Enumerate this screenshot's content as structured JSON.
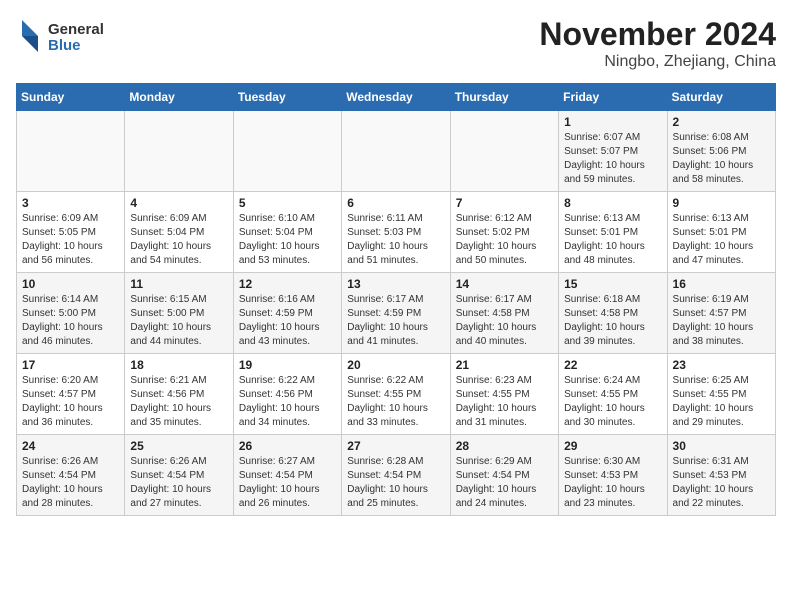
{
  "header": {
    "logo_general": "General",
    "logo_blue": "Blue",
    "title": "November 2024",
    "subtitle": "Ningbo, Zhejiang, China"
  },
  "weekdays": [
    "Sunday",
    "Monday",
    "Tuesday",
    "Wednesday",
    "Thursday",
    "Friday",
    "Saturday"
  ],
  "weeks": [
    [
      {
        "day": "",
        "detail": ""
      },
      {
        "day": "",
        "detail": ""
      },
      {
        "day": "",
        "detail": ""
      },
      {
        "day": "",
        "detail": ""
      },
      {
        "day": "",
        "detail": ""
      },
      {
        "day": "1",
        "detail": "Sunrise: 6:07 AM\nSunset: 5:07 PM\nDaylight: 10 hours and 59 minutes."
      },
      {
        "day": "2",
        "detail": "Sunrise: 6:08 AM\nSunset: 5:06 PM\nDaylight: 10 hours and 58 minutes."
      }
    ],
    [
      {
        "day": "3",
        "detail": "Sunrise: 6:09 AM\nSunset: 5:05 PM\nDaylight: 10 hours and 56 minutes."
      },
      {
        "day": "4",
        "detail": "Sunrise: 6:09 AM\nSunset: 5:04 PM\nDaylight: 10 hours and 54 minutes."
      },
      {
        "day": "5",
        "detail": "Sunrise: 6:10 AM\nSunset: 5:04 PM\nDaylight: 10 hours and 53 minutes."
      },
      {
        "day": "6",
        "detail": "Sunrise: 6:11 AM\nSunset: 5:03 PM\nDaylight: 10 hours and 51 minutes."
      },
      {
        "day": "7",
        "detail": "Sunrise: 6:12 AM\nSunset: 5:02 PM\nDaylight: 10 hours and 50 minutes."
      },
      {
        "day": "8",
        "detail": "Sunrise: 6:13 AM\nSunset: 5:01 PM\nDaylight: 10 hours and 48 minutes."
      },
      {
        "day": "9",
        "detail": "Sunrise: 6:13 AM\nSunset: 5:01 PM\nDaylight: 10 hours and 47 minutes."
      }
    ],
    [
      {
        "day": "10",
        "detail": "Sunrise: 6:14 AM\nSunset: 5:00 PM\nDaylight: 10 hours and 46 minutes."
      },
      {
        "day": "11",
        "detail": "Sunrise: 6:15 AM\nSunset: 5:00 PM\nDaylight: 10 hours and 44 minutes."
      },
      {
        "day": "12",
        "detail": "Sunrise: 6:16 AM\nSunset: 4:59 PM\nDaylight: 10 hours and 43 minutes."
      },
      {
        "day": "13",
        "detail": "Sunrise: 6:17 AM\nSunset: 4:59 PM\nDaylight: 10 hours and 41 minutes."
      },
      {
        "day": "14",
        "detail": "Sunrise: 6:17 AM\nSunset: 4:58 PM\nDaylight: 10 hours and 40 minutes."
      },
      {
        "day": "15",
        "detail": "Sunrise: 6:18 AM\nSunset: 4:58 PM\nDaylight: 10 hours and 39 minutes."
      },
      {
        "day": "16",
        "detail": "Sunrise: 6:19 AM\nSunset: 4:57 PM\nDaylight: 10 hours and 38 minutes."
      }
    ],
    [
      {
        "day": "17",
        "detail": "Sunrise: 6:20 AM\nSunset: 4:57 PM\nDaylight: 10 hours and 36 minutes."
      },
      {
        "day": "18",
        "detail": "Sunrise: 6:21 AM\nSunset: 4:56 PM\nDaylight: 10 hours and 35 minutes."
      },
      {
        "day": "19",
        "detail": "Sunrise: 6:22 AM\nSunset: 4:56 PM\nDaylight: 10 hours and 34 minutes."
      },
      {
        "day": "20",
        "detail": "Sunrise: 6:22 AM\nSunset: 4:55 PM\nDaylight: 10 hours and 33 minutes."
      },
      {
        "day": "21",
        "detail": "Sunrise: 6:23 AM\nSunset: 4:55 PM\nDaylight: 10 hours and 31 minutes."
      },
      {
        "day": "22",
        "detail": "Sunrise: 6:24 AM\nSunset: 4:55 PM\nDaylight: 10 hours and 30 minutes."
      },
      {
        "day": "23",
        "detail": "Sunrise: 6:25 AM\nSunset: 4:55 PM\nDaylight: 10 hours and 29 minutes."
      }
    ],
    [
      {
        "day": "24",
        "detail": "Sunrise: 6:26 AM\nSunset: 4:54 PM\nDaylight: 10 hours and 28 minutes."
      },
      {
        "day": "25",
        "detail": "Sunrise: 6:26 AM\nSunset: 4:54 PM\nDaylight: 10 hours and 27 minutes."
      },
      {
        "day": "26",
        "detail": "Sunrise: 6:27 AM\nSunset: 4:54 PM\nDaylight: 10 hours and 26 minutes."
      },
      {
        "day": "27",
        "detail": "Sunrise: 6:28 AM\nSunset: 4:54 PM\nDaylight: 10 hours and 25 minutes."
      },
      {
        "day": "28",
        "detail": "Sunrise: 6:29 AM\nSunset: 4:54 PM\nDaylight: 10 hours and 24 minutes."
      },
      {
        "day": "29",
        "detail": "Sunrise: 6:30 AM\nSunset: 4:53 PM\nDaylight: 10 hours and 23 minutes."
      },
      {
        "day": "30",
        "detail": "Sunrise: 6:31 AM\nSunset: 4:53 PM\nDaylight: 10 hours and 22 minutes."
      }
    ]
  ]
}
